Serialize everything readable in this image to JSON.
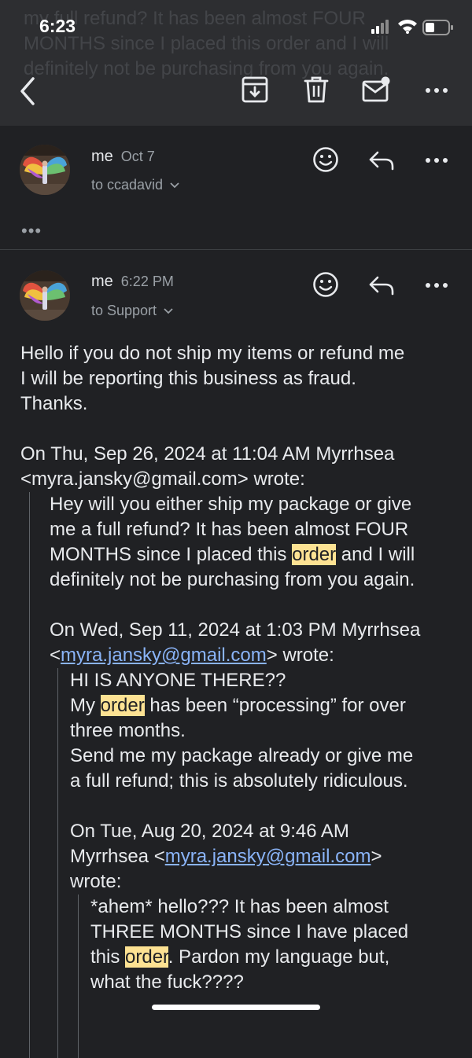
{
  "status_bar": {
    "time": "6:23"
  },
  "background_preview": [
    "my full refund? It has been almost FOUR",
    "MONTHS since I placed this order and I will",
    "definitely not be purchasing from you again."
  ],
  "toolbar": {
    "back": "back",
    "archive": "archive",
    "delete": "delete",
    "mark_unread": "mark unread",
    "more": "more"
  },
  "collapsed_message": {
    "sender": "me",
    "date": "Oct 7",
    "recipient": "to ccadavid",
    "expand_label": "•••"
  },
  "open_message": {
    "sender": "me",
    "date": "6:22 PM",
    "recipient": "to Support",
    "body": {
      "line1": "Hello if you do not ship my items or refund me",
      "line2": "I will be reporting this business as fraud.",
      "line3": "Thanks.",
      "quote1_header_1": "On Thu, Sep 26, 2024 at 11:04 AM Myrrhsea",
      "quote1_header_2": "<myra.jansky@gmail.com> wrote:",
      "q1_l1": "Hey will you either ship my package or give",
      "q1_l2": "me a full refund? It has been almost FOUR",
      "q1_l3a": "MONTHS since I placed this ",
      "q1_l3b": "order",
      "q1_l3c": " and I will",
      "q1_l4": "definitely not be purchasing from you again.",
      "q2_header_1": "On Wed, Sep 11, 2024 at 1:03 PM Myrrhsea",
      "q2_header_2a": "<",
      "q2_header_2b": "myra.jansky@gmail.com",
      "q2_header_2c": "> wrote:",
      "q2_l1": "HI IS ANYONE THERE??",
      "q2_l2a": "My ",
      "q2_l2b": "order",
      "q2_l2c": " has been “processing” for over",
      "q2_l3": "three months.",
      "q2_l4": "Send me my package already or give me",
      "q2_l5": "a full refund; this is absolutely ridiculous.",
      "q3_header_1": "On Tue, Aug 20, 2024 at 9:46 AM",
      "q3_header_2a": "Myrrhsea <",
      "q3_header_2b": "myra.jansky@gmail.com",
      "q3_header_2c": ">",
      "q3_header_3": "wrote:",
      "q3_l1": "*ahem* hello??? It has been almost",
      "q3_l2": "THREE MONTHS since I have placed",
      "q3_l3a": "this ",
      "q3_l3b": "order",
      "q3_l3c": ". Pardon my language but,",
      "q3_l4": "what the fuck????"
    }
  },
  "icons": {
    "emoji": "smiley-icon",
    "reply": "reply-icon",
    "more": "more-horizontal-icon"
  },
  "colors": {
    "background": "#202124",
    "header": "#2d2e31",
    "highlight": "#fde293",
    "link": "#8ab4f8"
  }
}
